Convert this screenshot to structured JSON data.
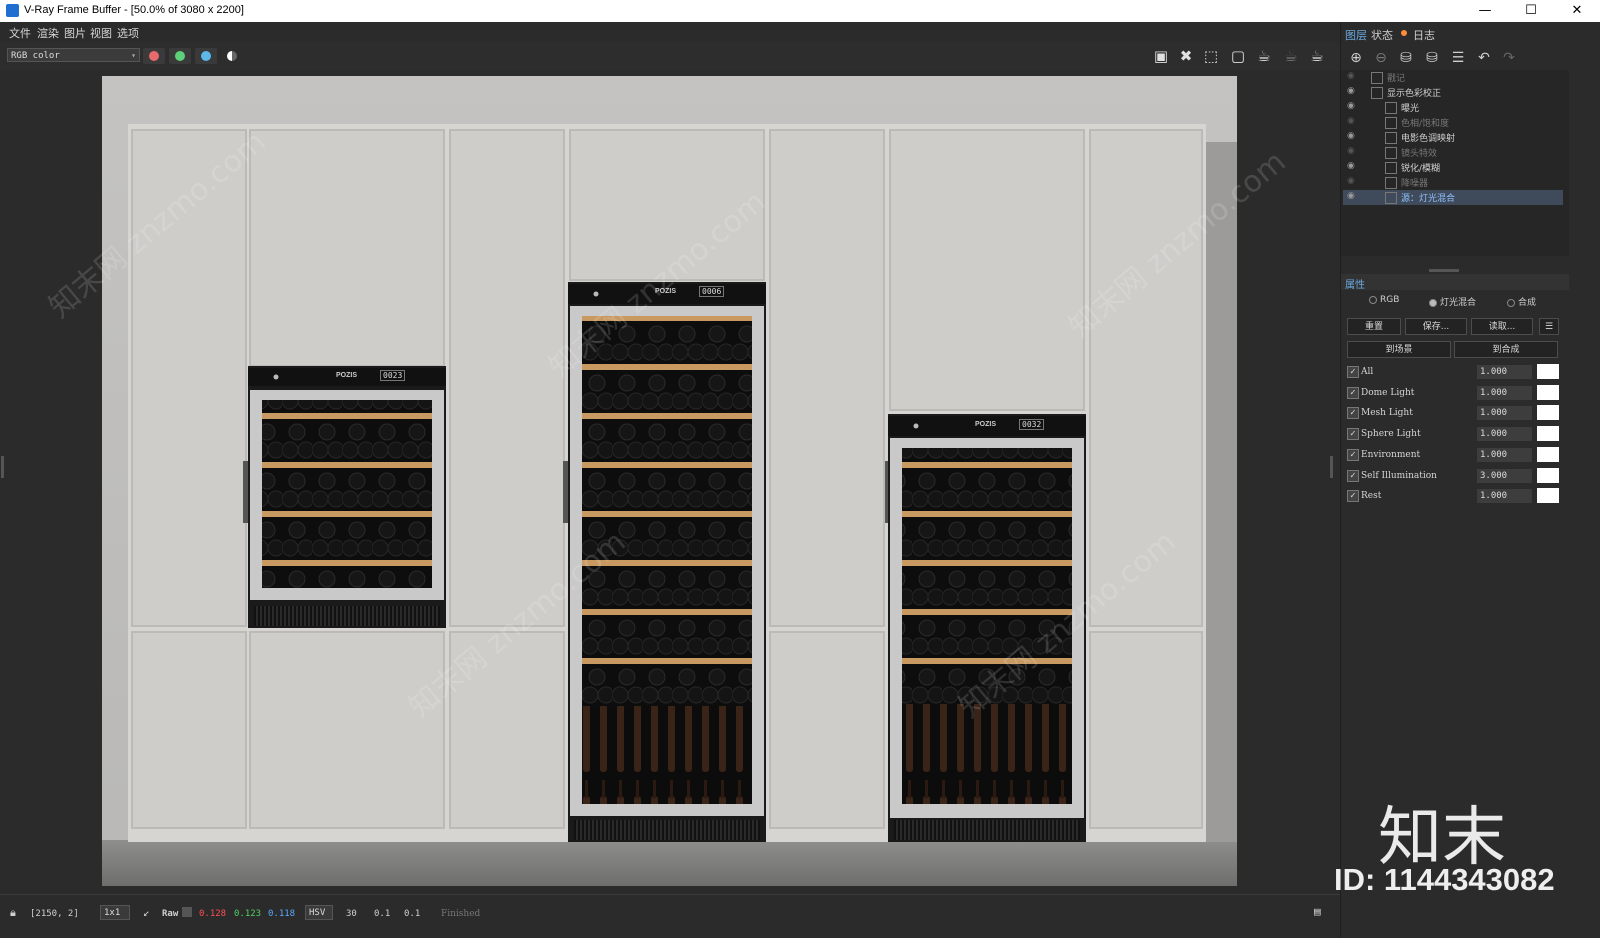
{
  "window": {
    "title": "V-Ray Frame Buffer - [50.0% of 3080 x 2200]",
    "minimize": "—",
    "maximize": "☐",
    "close": "✕"
  },
  "menu": [
    "文件",
    "渲染",
    "图片",
    "视图",
    "选项"
  ],
  "toolbar": {
    "channel_select": "RGB color"
  },
  "colors": {
    "red_channel": "#e86b6b",
    "green_channel": "#5ed07a",
    "blue_channel": "#5fb8ea",
    "accent_tab": "#6aa9e0",
    "log_dot": "#ff8c3a"
  },
  "render": {
    "fridges": [
      {
        "brand": "POZIS",
        "display": "0023"
      },
      {
        "brand": "POZIS",
        "display": "0006"
      },
      {
        "brand": "POZIS",
        "display": "0032"
      }
    ]
  },
  "status": {
    "coords": "[2150, 2]",
    "zoom": "1x1",
    "raw": "Raw",
    "r": "0.128",
    "g": "0.123",
    "b": "0.118",
    "mode": "HSV",
    "v1": "30",
    "v2": "0.1",
    "v3": "0.1",
    "state": "Finished"
  },
  "panel": {
    "tabs": [
      "图层",
      "状态",
      "日志"
    ],
    "layers": [
      {
        "label": "戳记",
        "indent": 0,
        "dim": true
      },
      {
        "label": "显示色彩校正",
        "indent": 0,
        "dim": false
      },
      {
        "label": "曝光",
        "indent": 1,
        "dim": false
      },
      {
        "label": "色相/饱和度",
        "indent": 1,
        "dim": true
      },
      {
        "label": "电影色调映射",
        "indent": 1,
        "dim": false
      },
      {
        "label": "镜头特效",
        "indent": 1,
        "dim": true
      },
      {
        "label": "锐化/模糊",
        "indent": 1,
        "dim": false
      },
      {
        "label": "降噪器",
        "indent": 1,
        "dim": true
      },
      {
        "label": "源：灯光混合",
        "indent": 1,
        "dim": false,
        "selected": true
      }
    ],
    "properties_title": "属性",
    "radio": [
      "RGB",
      "灯光混合",
      "合成"
    ],
    "buttons": {
      "reset": "重置",
      "save": "保存...",
      "load": "读取...",
      "to_scene": "到场景",
      "to_comp": "到合成"
    },
    "lights": [
      {
        "name": "All",
        "value": "1.000"
      },
      {
        "name": "Dome Light",
        "value": "1.000"
      },
      {
        "name": "Mesh Light",
        "value": "1.000"
      },
      {
        "name": "Sphere Light",
        "value": "1.000"
      },
      {
        "name": "Environment",
        "value": "1.000"
      },
      {
        "name": "Self Illumination",
        "value": "3.000"
      },
      {
        "name": "Rest",
        "value": "1.000"
      }
    ]
  },
  "watermark": {
    "site": "znzmo.com",
    "brand": "知末",
    "id": "ID: 1144343082",
    "cn": "知末网"
  }
}
